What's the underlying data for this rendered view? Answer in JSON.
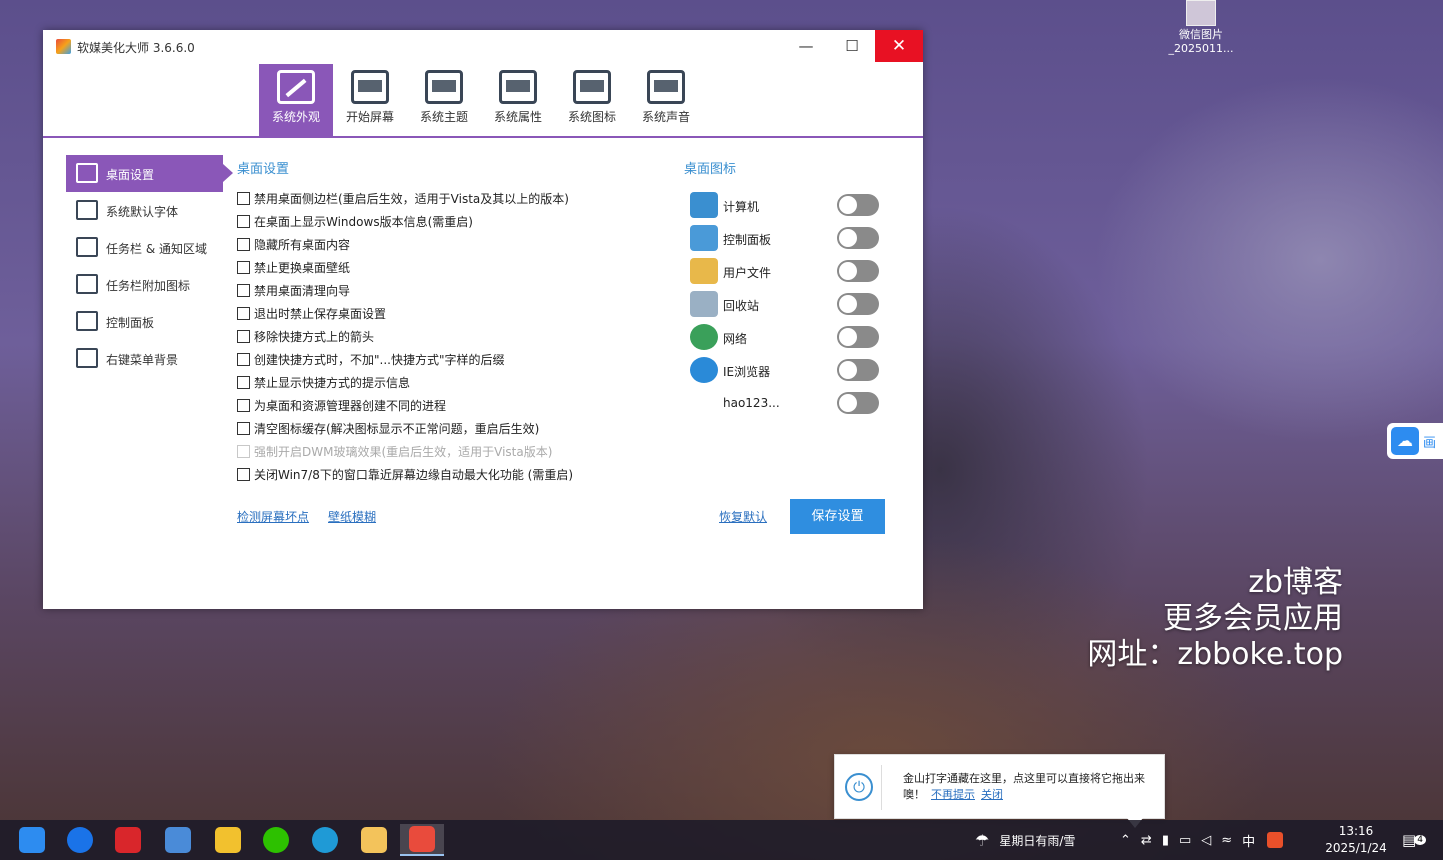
{
  "desktop": {
    "icon_label_1": "微信图片",
    "icon_label_2": "_2025011...",
    "watermark": [
      "zb博客",
      "更多会员应用",
      "网址：zbboke.top"
    ],
    "float_text": "画"
  },
  "window": {
    "title": "软媒美化大师 3.6.6.0",
    "controls": {
      "minimize": "—",
      "maximize": "☐",
      "close": "✕"
    }
  },
  "toolbar": [
    {
      "label": "系统外观",
      "icon": "brush-icon",
      "active": true
    },
    {
      "label": "开始屏幕",
      "icon": "keyboard-icon",
      "active": false
    },
    {
      "label": "系统主题",
      "icon": "tshirt-icon",
      "active": false
    },
    {
      "label": "系统属性",
      "icon": "oem-icon",
      "active": false
    },
    {
      "label": "系统图标",
      "icon": "star-icon",
      "active": false
    },
    {
      "label": "系统声音",
      "icon": "speaker-icon",
      "active": false
    }
  ],
  "sidebar": [
    {
      "label": "桌面设置",
      "icon": "desktop-settings-icon",
      "active": true
    },
    {
      "label": "系统默认字体",
      "icon": "font-icon",
      "active": false
    },
    {
      "label": "任务栏 & 通知区域",
      "icon": "taskbar-icon",
      "active": false
    },
    {
      "label": "任务栏附加图标",
      "icon": "taskbar-extra-icon",
      "active": false
    },
    {
      "label": "控制面板",
      "icon": "control-panel-icon",
      "active": false
    },
    {
      "label": "右键菜单背景",
      "icon": "context-menu-icon",
      "active": false
    }
  ],
  "settings": {
    "heading": "桌面设置",
    "options": [
      {
        "label": "禁用桌面侧边栏(重启后生效，适用于Vista及其以上的版本)",
        "checked": false,
        "disabled": false
      },
      {
        "label": "在桌面上显示Windows版本信息(需重启)",
        "checked": false,
        "disabled": false
      },
      {
        "label": "隐藏所有桌面内容",
        "checked": false,
        "disabled": false
      },
      {
        "label": "禁止更换桌面壁纸",
        "checked": false,
        "disabled": false
      },
      {
        "label": "禁用桌面清理向导",
        "checked": false,
        "disabled": false
      },
      {
        "label": "退出时禁止保存桌面设置",
        "checked": false,
        "disabled": false
      },
      {
        "label": "移除快捷方式上的箭头",
        "checked": false,
        "disabled": false
      },
      {
        "label": "创建快捷方式时，不加\"...快捷方式\"字样的后缀",
        "checked": false,
        "disabled": false
      },
      {
        "label": "禁止显示快捷方式的提示信息",
        "checked": false,
        "disabled": false
      },
      {
        "label": "为桌面和资源管理器创建不同的进程",
        "checked": false,
        "disabled": false
      },
      {
        "label": "清空图标缓存(解决图标显示不正常问题，重启后生效)",
        "checked": false,
        "disabled": false
      },
      {
        "label": "强制开启DWM玻璃效果(重启后生效，适用于Vista版本)",
        "checked": false,
        "disabled": true
      },
      {
        "label": "关闭Win7/8下的窗口靠近屏幕边缘自动最大化功能 (需重启)",
        "checked": false,
        "disabled": false
      }
    ],
    "link_check_pixels": "检测屏幕坏点",
    "link_wallpaper_blur": "壁纸模糊",
    "restore_default": "恢复默认",
    "save_label": "保存设置"
  },
  "desktop_icons": {
    "heading": "桌面图标",
    "items": [
      {
        "label": "计算机",
        "icon": "computer-icon",
        "color": "#3a8fd0",
        "on": false
      },
      {
        "label": "控制面板",
        "icon": "control-panel-icon",
        "color": "#4a9ad8",
        "on": false
      },
      {
        "label": "用户文件",
        "icon": "user-folder-icon",
        "color": "#e8b84a",
        "on": false
      },
      {
        "label": "回收站",
        "icon": "recycle-bin-icon",
        "color": "#9ab0c4",
        "on": false
      },
      {
        "label": "网络",
        "icon": "network-icon",
        "color": "#3aa05a",
        "on": false
      },
      {
        "label": "IE浏览器",
        "icon": "ie-icon",
        "color": "#2a8ad8",
        "on": false
      },
      {
        "label": "hao123...",
        "icon": "hao123-icon",
        "color": "#ffffff",
        "on": false
      }
    ]
  },
  "notification": {
    "message": "金山打字通藏在这里，点这里可以直接将它拖出来噢！",
    "link_never": "不再提示",
    "link_close": "关闭"
  },
  "taskbar": {
    "apps": [
      {
        "name": "taskbar-app-1",
        "color": "#2d8cf0"
      },
      {
        "name": "taskbar-app-2",
        "color": "#1a73e8"
      },
      {
        "name": "taskbar-app-wps",
        "color": "#d9262b"
      },
      {
        "name": "taskbar-app-4",
        "color": "#4a8bd8"
      },
      {
        "name": "taskbar-app-5",
        "color": "#f2c12e"
      },
      {
        "name": "taskbar-app-wechat",
        "color": "#2dc100"
      },
      {
        "name": "taskbar-app-edge",
        "color": "#1f9ad6"
      },
      {
        "name": "taskbar-app-explorer",
        "color": "#f3c35b"
      },
      {
        "name": "taskbar-app-beautifier",
        "color": "#e94b3c"
      }
    ],
    "weather": "星期日有雨/雪",
    "ime": "中",
    "time": "13:16",
    "date": "2025/1/24",
    "notif_count": "4"
  }
}
